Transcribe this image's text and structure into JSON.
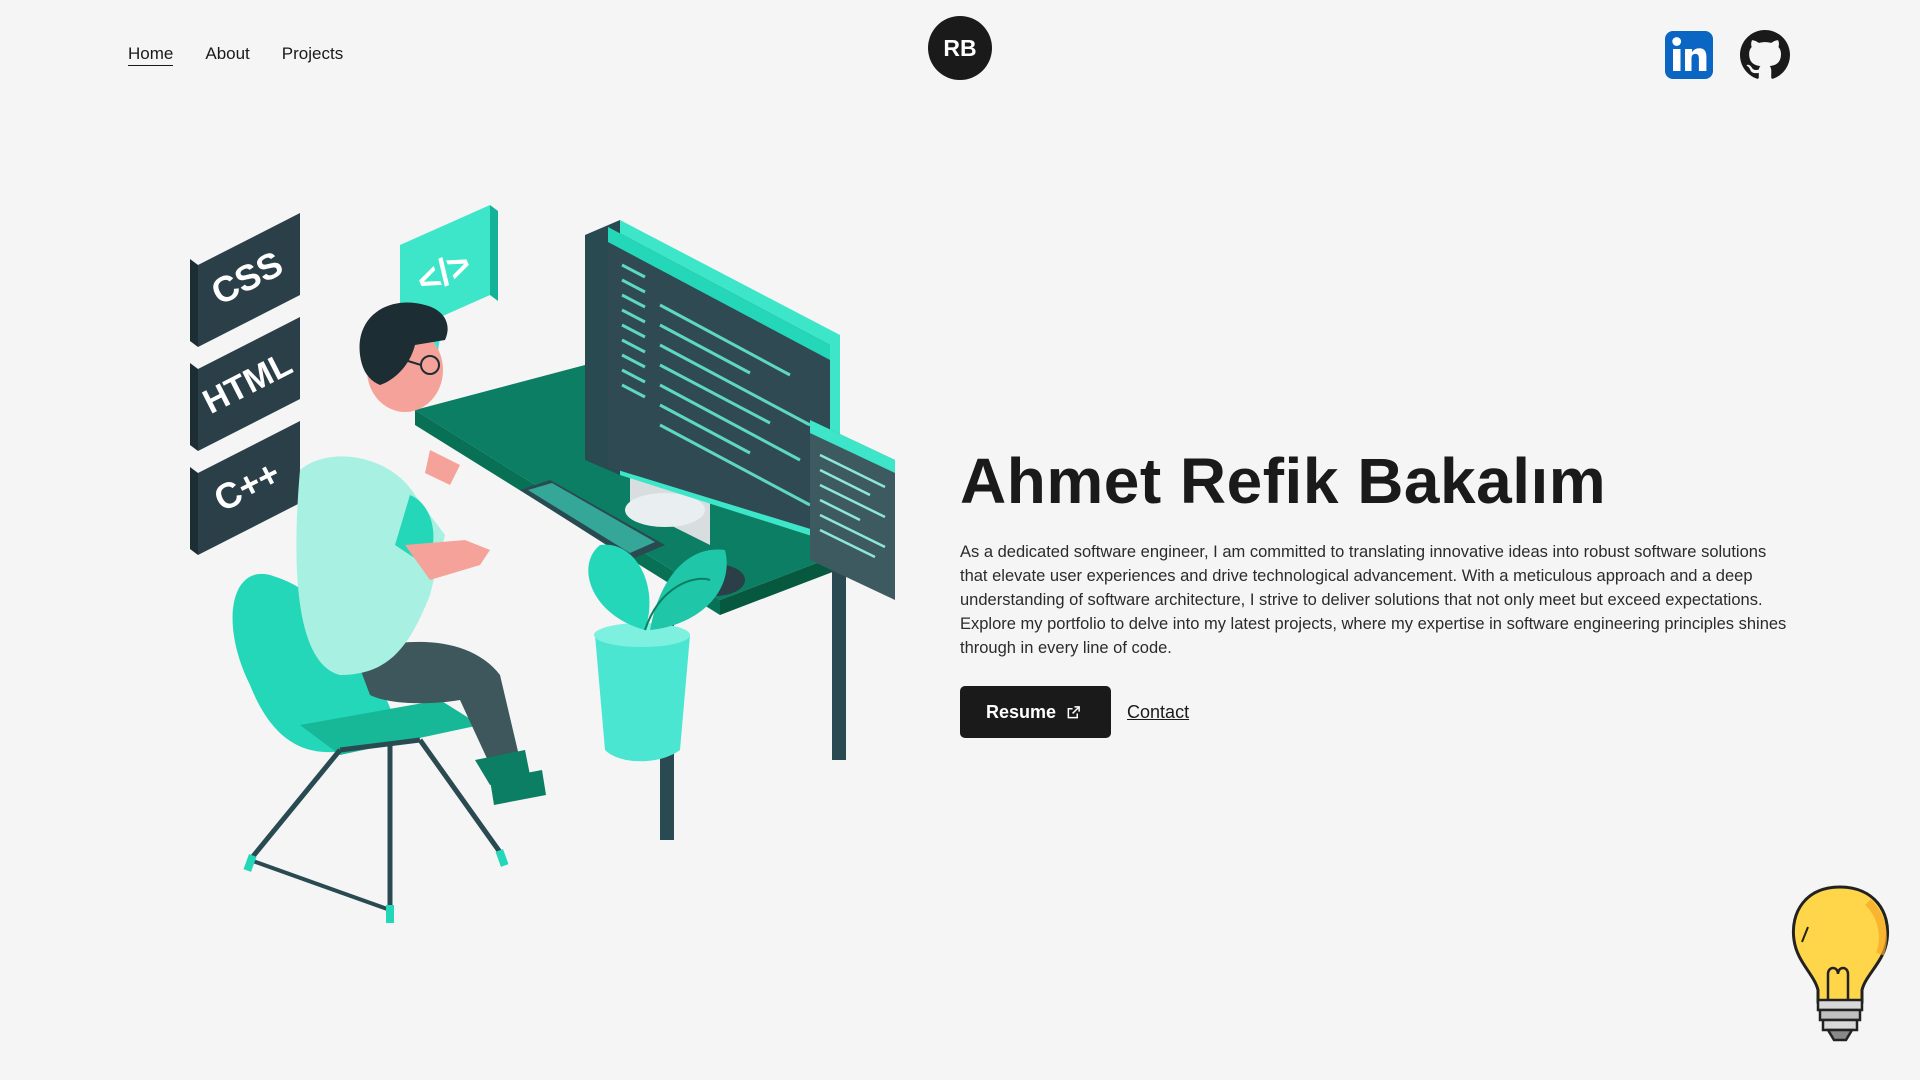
{
  "nav": {
    "items": [
      {
        "label": "Home",
        "active": true
      },
      {
        "label": "About",
        "active": false
      },
      {
        "label": "Projects",
        "active": false
      }
    ]
  },
  "logo": {
    "initials": "RB"
  },
  "social": {
    "items": [
      {
        "icon": "linkedin-icon",
        "color": "#0a66c2"
      },
      {
        "icon": "github-icon",
        "color": "#1a1a1a"
      }
    ]
  },
  "illustration": {
    "badges": [
      "CSS",
      "HTML",
      "C++"
    ],
    "code_bubble": "</>",
    "accent_color": "#18d6b5",
    "desk_color": "#0b7e64"
  },
  "hero": {
    "name": "Ahmet Refik Bakalım",
    "bio": "As a dedicated software engineer, I am committed to translating innovative ideas into robust software solutions that elevate user experiences and drive technological advancement. With a meticulous approach and a deep understanding of software architecture, I strive to deliver solutions that not only meet but exceed expectations. Explore my portfolio to delve into my latest projects, where my expertise in software engineering principles shines through in every line of code.",
    "resume_label": "Resume",
    "resume_icon": "external-link-icon",
    "contact_label": "Contact"
  },
  "theme_toggle": {
    "icon": "lightbulb-icon",
    "color": "#ffd54a"
  }
}
